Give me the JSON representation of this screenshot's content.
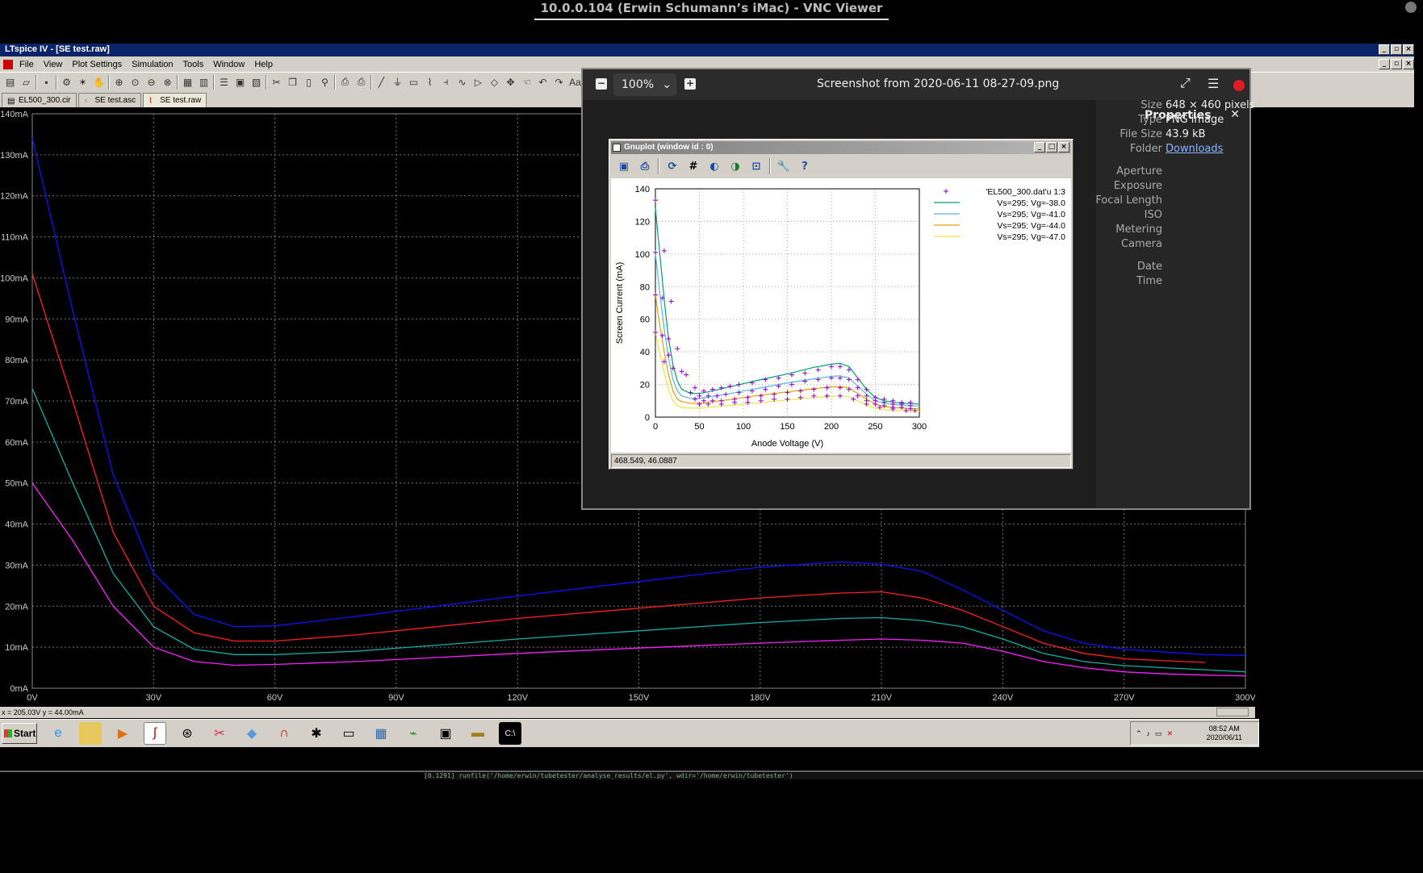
{
  "vnc": {
    "title": "10.0.0.104 (Erwin Schumann’s iMac) - VNC Viewer"
  },
  "ltspice": {
    "title": "LTspice IV - [SE test.raw]",
    "menu": [
      "File",
      "View",
      "Plot Settings",
      "Simulation",
      "Tools",
      "Window",
      "Help"
    ],
    "tabs": [
      "EL500_300.cir",
      "SE test.asc",
      "SE test.raw"
    ],
    "status": "x = 205.03V   y = 44.00mA",
    "colors": {
      "blue": "#1010ff",
      "red": "#ff2020",
      "teal": "#10b0a8",
      "magenta": "#ff20ff"
    }
  },
  "chart_data": [
    {
      "type": "line",
      "title": "",
      "xlabel": "",
      "ylabel": "",
      "xlim": [
        0,
        300
      ],
      "ylim": [
        0,
        140
      ],
      "x_ticks": [
        "0V",
        "30V",
        "60V",
        "90V",
        "120V",
        "150V",
        "180V",
        "210V",
        "240V",
        "270V",
        "300V"
      ],
      "y_ticks": [
        "0mA",
        "10mA",
        "20mA",
        "30mA",
        "40mA",
        "50mA",
        "60mA",
        "70mA",
        "80mA",
        "90mA",
        "100mA",
        "110mA",
        "120mA",
        "130mA",
        "140mA"
      ],
      "grid": true,
      "x": [
        0,
        10,
        20,
        30,
        40,
        50,
        60,
        80,
        100,
        120,
        150,
        180,
        200,
        210,
        220,
        230,
        240,
        250,
        260,
        270,
        280,
        290,
        300
      ],
      "series": [
        {
          "color": "#1010ff",
          "values": [
            134,
            92,
            52,
            28,
            18,
            15,
            15.2,
            17.5,
            20,
            22.5,
            26,
            29.5,
            30.8,
            30.2,
            28.5,
            24,
            19,
            14,
            11,
            9.5,
            8.8,
            8.2,
            8
          ]
        },
        {
          "color": "#ff2020",
          "values": [
            101,
            70,
            38,
            20,
            13.5,
            11.5,
            11.5,
            13,
            15,
            17,
            19.5,
            22,
            23.2,
            23.5,
            22,
            19,
            15,
            11,
            8.5,
            7.2,
            6.7,
            6.3,
            null
          ]
        },
        {
          "color": "#10b0a8",
          "values": [
            73,
            50,
            28,
            15,
            9.5,
            8.2,
            8.2,
            9,
            10.5,
            12,
            14,
            16,
            17,
            17.2,
            16.5,
            15,
            12,
            8.5,
            6.5,
            5.5,
            5,
            4.5,
            4
          ]
        },
        {
          "color": "#ff20ff",
          "values": [
            50,
            36,
            20,
            10,
            6.5,
            5.6,
            5.8,
            6.5,
            7.5,
            8.5,
            9.8,
            11,
            11.7,
            12,
            11.7,
            11,
            9,
            6.5,
            5,
            4,
            3.5,
            3.2,
            3
          ]
        }
      ]
    },
    {
      "type": "line",
      "title": "",
      "xlabel": "Anode Voltage (V)",
      "ylabel": "Screen Current (mA)",
      "xlim": [
        0,
        300
      ],
      "ylim": [
        0,
        140
      ],
      "x_ticks": [
        "0",
        "50",
        "100",
        "150",
        "200",
        "250",
        "300"
      ],
      "y_ticks": [
        "0",
        "20",
        "40",
        "60",
        "80",
        "100",
        "120",
        "140"
      ],
      "grid": true,
      "legend_position": "top-right",
      "legend": [
        "'EL500_300.dat'u 1:3",
        "Vs=295; Vg=-38.0",
        "Vs=295; Vg=-41.0",
        "Vs=295; Vg=-44.0",
        "Vs=295; Vg=-47.0"
      ],
      "x": [
        0,
        5,
        10,
        15,
        20,
        25,
        30,
        40,
        50,
        60,
        80,
        100,
        120,
        150,
        180,
        200,
        210,
        220,
        230,
        240,
        250,
        260,
        280,
        300
      ],
      "series": [
        {
          "name": "Vs=295; Vg=-38.0",
          "color": "#009e73",
          "values": [
            128,
            100,
            72,
            48,
            32,
            22,
            17,
            14.5,
            14.5,
            15.5,
            18,
            20.5,
            23,
            26.5,
            30.5,
            32.5,
            33,
            31,
            24,
            17,
            12,
            10,
            8.5,
            8
          ]
        },
        {
          "name": "Vs=295; Vg=-41.0",
          "color": "#56b4e9",
          "values": [
            100,
            76,
            54,
            36,
            23,
            16,
            13,
            11.5,
            11.5,
            12.3,
            14,
            16,
            18,
            21,
            23.5,
            25,
            25.3,
            24,
            19,
            14,
            10,
            8.5,
            7.2,
            6.8
          ]
        },
        {
          "name": "Vs=295; Vg=-44.0",
          "color": "#e69f00",
          "values": [
            75,
            56,
            40,
            26,
            16,
            11,
            9.5,
            8.5,
            8.5,
            9,
            10.5,
            12,
            13.5,
            15.5,
            17.5,
            18.5,
            18.7,
            18,
            14.5,
            11,
            8,
            6.5,
            5.5,
            5
          ]
        },
        {
          "name": "Vs=295; Vg=-47.0",
          "color": "#f0e442",
          "values": [
            52,
            39,
            27,
            17,
            10,
            7,
            6,
            5.5,
            5.5,
            6,
            7,
            8,
            9,
            10.5,
            12,
            12.8,
            13,
            12.5,
            10,
            7.5,
            5.5,
            4.5,
            3.8,
            3.5
          ]
        }
      ],
      "points_name": "'EL500_300.dat'u 1:3",
      "points_color": "#9400d3",
      "points": [
        [
          0,
          133
        ],
        [
          10,
          102
        ],
        [
          0,
          101
        ],
        [
          18,
          71
        ],
        [
          0,
          75
        ],
        [
          8,
          73
        ],
        [
          15,
          48
        ],
        [
          0,
          52
        ],
        [
          8,
          50
        ],
        [
          25,
          42
        ],
        [
          15,
          38
        ],
        [
          30,
          28
        ],
        [
          10,
          34
        ],
        [
          20,
          30
        ],
        [
          35,
          26
        ],
        [
          45,
          18
        ],
        [
          55,
          16
        ],
        [
          65,
          17
        ],
        [
          75,
          18
        ],
        [
          85,
          19
        ],
        [
          95,
          20
        ],
        [
          110,
          21
        ],
        [
          125,
          23
        ],
        [
          140,
          24
        ],
        [
          155,
          26
        ],
        [
          170,
          27
        ],
        [
          185,
          29
        ],
        [
          200,
          31
        ],
        [
          210,
          31
        ],
        [
          220,
          29
        ],
        [
          230,
          23
        ],
        [
          240,
          17
        ],
        [
          250,
          12
        ],
        [
          260,
          11
        ],
        [
          270,
          10
        ],
        [
          280,
          9
        ],
        [
          290,
          9
        ],
        [
          40,
          15
        ],
        [
          50,
          13
        ],
        [
          60,
          13
        ],
        [
          70,
          13
        ],
        [
          80,
          14
        ],
        [
          95,
          15
        ],
        [
          110,
          16
        ],
        [
          125,
          17
        ],
        [
          140,
          19
        ],
        [
          155,
          20
        ],
        [
          170,
          22
        ],
        [
          185,
          23
        ],
        [
          200,
          24
        ],
        [
          210,
          24
        ],
        [
          220,
          23
        ],
        [
          230,
          18
        ],
        [
          240,
          13
        ],
        [
          250,
          10
        ],
        [
          260,
          9
        ],
        [
          270,
          8
        ],
        [
          280,
          8
        ],
        [
          290,
          7
        ],
        [
          45,
          11
        ],
        [
          55,
          10
        ],
        [
          65,
          10
        ],
        [
          75,
          10
        ],
        [
          90,
          11
        ],
        [
          105,
          12
        ],
        [
          120,
          13
        ],
        [
          135,
          14
        ],
        [
          150,
          15
        ],
        [
          165,
          16
        ],
        [
          180,
          17
        ],
        [
          195,
          18
        ],
        [
          210,
          18
        ],
        [
          220,
          17
        ],
        [
          230,
          13
        ],
        [
          240,
          10
        ],
        [
          250,
          8
        ],
        [
          260,
          7
        ],
        [
          270,
          6
        ],
        [
          280,
          6
        ],
        [
          290,
          5
        ],
        [
          50,
          8
        ],
        [
          60,
          8
        ],
        [
          75,
          8
        ],
        [
          90,
          9
        ],
        [
          105,
          9
        ],
        [
          120,
          10
        ],
        [
          135,
          11
        ],
        [
          150,
          11
        ],
        [
          165,
          12
        ],
        [
          180,
          13
        ],
        [
          195,
          13
        ],
        [
          210,
          13
        ],
        [
          225,
          11
        ],
        [
          240,
          8
        ],
        [
          255,
          6
        ],
        [
          270,
          5
        ],
        [
          285,
          4
        ],
        [
          295,
          4
        ]
      ]
    }
  ],
  "viewer": {
    "zoom": "100%",
    "title": "Screenshot from 2020-06-11 08-27-09.png",
    "properties_title": "Properties",
    "props": [
      {
        "k": "Size",
        "v": "648 × 460 pixels"
      },
      {
        "k": "Type",
        "v": "PNG image"
      },
      {
        "k": "File Size",
        "v": "43.9 kB"
      },
      {
        "k": "Folder",
        "v": "Downloads"
      },
      {
        "k": "Aperture",
        "v": ""
      },
      {
        "k": "Exposure",
        "v": ""
      },
      {
        "k": "Focal Length",
        "v": ""
      },
      {
        "k": "ISO",
        "v": ""
      },
      {
        "k": "Metering",
        "v": ""
      },
      {
        "k": "Camera",
        "v": ""
      },
      {
        "k": "Date",
        "v": ""
      },
      {
        "k": "Time",
        "v": ""
      }
    ]
  },
  "gnuplot": {
    "title": "Gnuplot (window id : 0)",
    "status": "468.549, 46.0887"
  },
  "taskbar": {
    "start": "Start",
    "time": "08:52 AM",
    "date": "2020/06/11",
    "icons": [
      "ie-icon",
      "folder-icon",
      "media-icon",
      "ltspice-icon",
      "network-icon",
      "scissors-icon",
      "eraser-icon",
      "magnet-icon",
      "document-icon",
      "folder2-icon",
      "calculator-icon",
      "chart-icon",
      "clipboard-icon",
      "drive-icon",
      "terminal-icon"
    ]
  },
  "terminal": {
    "text": "[0.1291] runfile('/home/erwin/tubetester/analyse_results/el.py', wdir='/home/erwin/tubetester')"
  }
}
